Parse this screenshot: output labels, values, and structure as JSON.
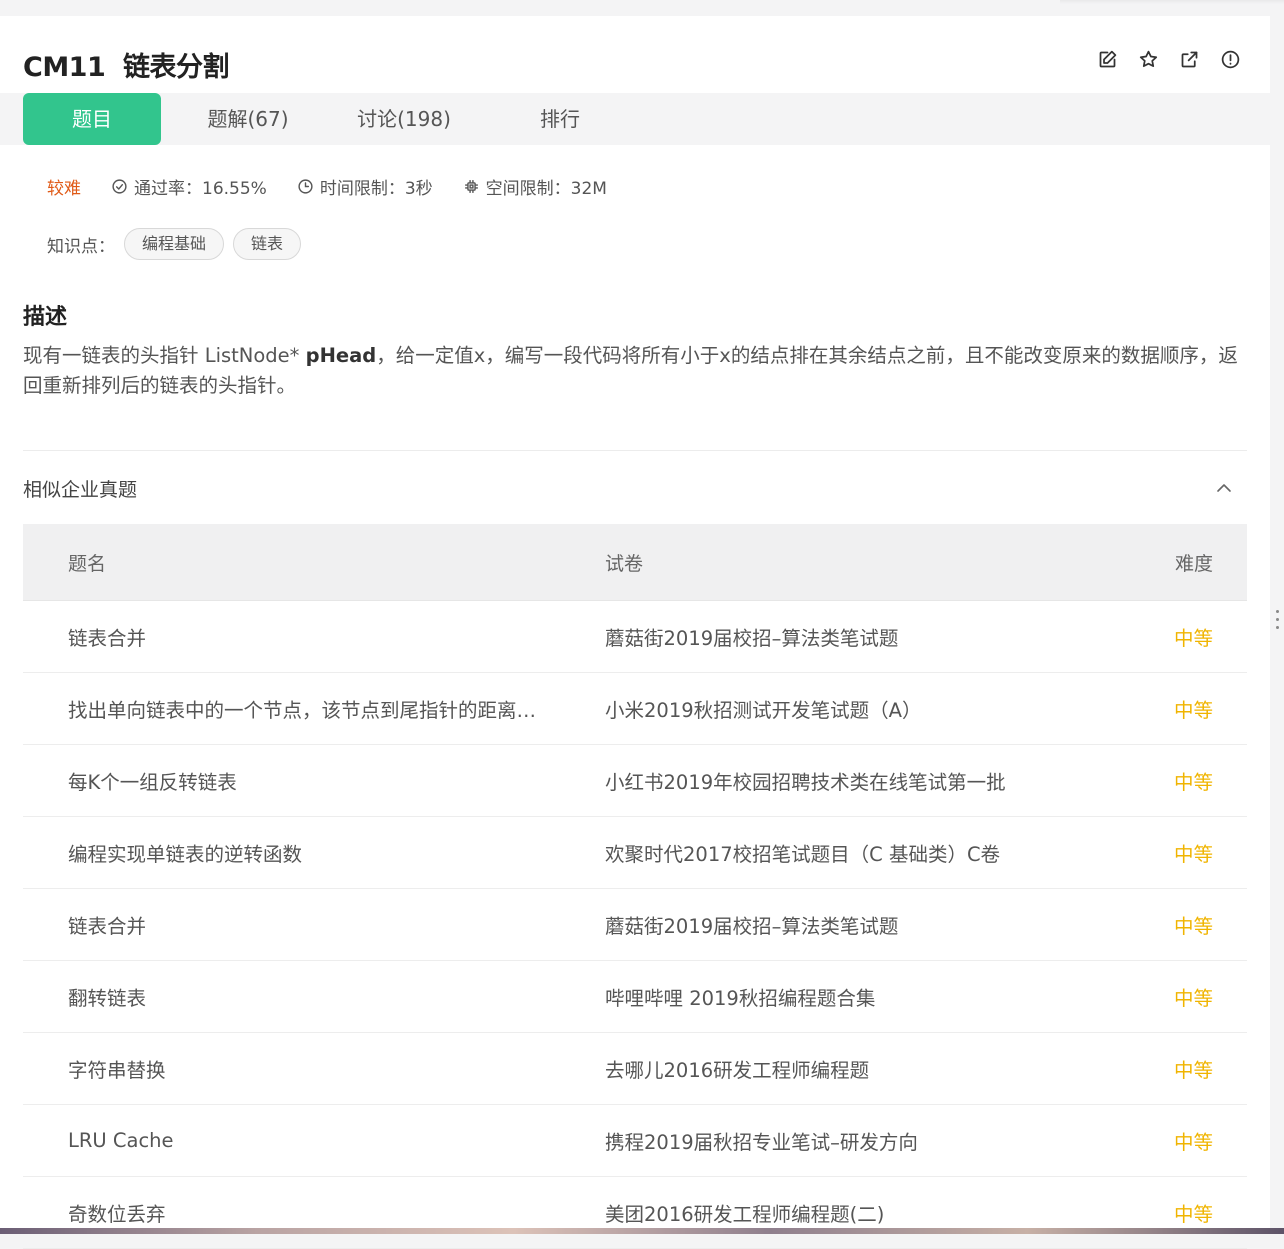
{
  "header": {
    "title": "CM11  链表分割",
    "icons": [
      "edit-icon",
      "star-icon",
      "share-icon",
      "report-icon"
    ]
  },
  "tabs": [
    {
      "label": "题目",
      "active": true
    },
    {
      "label": "题解(67)",
      "active": false
    },
    {
      "label": "讨论(198)",
      "active": false
    },
    {
      "label": "排行",
      "active": false
    }
  ],
  "meta": {
    "difficulty": "较难",
    "pass_rate": "通过率：16.55%",
    "time_limit": "时间限制：3秒",
    "space_limit": "空间限制：32M"
  },
  "knowledge": {
    "label": "知识点：",
    "tags": [
      "编程基础",
      "链表"
    ]
  },
  "description": {
    "heading": "描述",
    "text_before": "现有一链表的头指针 ListNode* ",
    "text_bold": "pHead",
    "text_after": "，给一定值x，编写一段代码将所有小于x的结点排在其余结点之前，且不能改变原来的数据顺序，返回重新排列后的链表的头指针。"
  },
  "similar": {
    "heading": "相似企业真题",
    "columns": [
      "题名",
      "试卷",
      "难度"
    ],
    "rows": [
      {
        "name": "链表合并",
        "paper": "蘑菇街2019届校招–算法类笔试题",
        "level": "中等"
      },
      {
        "name": "找出单向链表中的一个节点，该节点到尾指针的距离…",
        "paper": "小米2019秋招测试开发笔试题（A）",
        "level": "中等"
      },
      {
        "name": "每K个一组反转链表",
        "paper": "小红书2019年校园招聘技术类在线笔试第一批",
        "level": "中等"
      },
      {
        "name": "编程实现单链表的逆转函数",
        "paper": "欢聚时代2017校招笔试题目（C 基础类）C卷",
        "level": "中等"
      },
      {
        "name": "链表合并",
        "paper": "蘑菇街2019届校招–算法类笔试题",
        "level": "中等"
      },
      {
        "name": "翻转链表",
        "paper": "哔哩哔哩 2019秋招编程题合集",
        "level": "中等"
      },
      {
        "name": "字符串替换",
        "paper": "去哪儿2016研发工程师编程题",
        "level": "中等"
      },
      {
        "name": "LRU Cache",
        "paper": "携程2019届秋招专业笔试–研发方向",
        "level": "中等"
      },
      {
        "name": "奇数位丢弃",
        "paper": "美团2016研发工程师编程题(二)",
        "level": "中等"
      }
    ]
  },
  "colors": {
    "accent": "#32c58d",
    "hard": "#e05a17",
    "medium": "#f0b400"
  }
}
